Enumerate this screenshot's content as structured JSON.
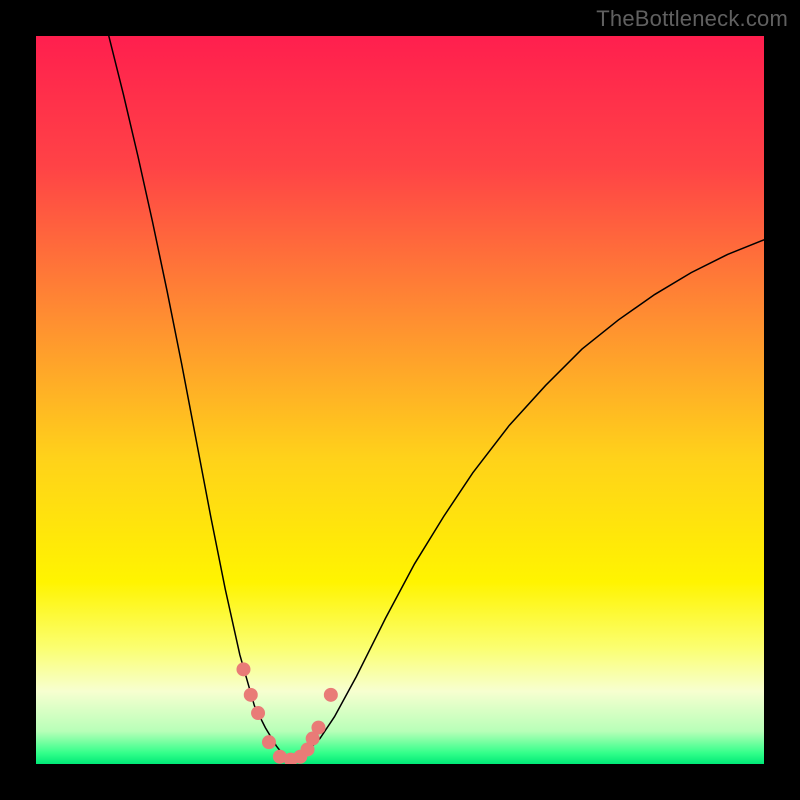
{
  "watermark": "TheBottleneck.com",
  "chart_data": {
    "type": "line",
    "title": "",
    "xlabel": "",
    "ylabel": "",
    "xlim": [
      0,
      100
    ],
    "ylim": [
      0,
      100
    ],
    "grid": false,
    "background_gradient": {
      "direction": "vertical",
      "stops": [
        {
          "offset": 0.0,
          "color": "#ff1f4e"
        },
        {
          "offset": 0.18,
          "color": "#ff4346"
        },
        {
          "offset": 0.38,
          "color": "#ff8b32"
        },
        {
          "offset": 0.58,
          "color": "#ffd21a"
        },
        {
          "offset": 0.75,
          "color": "#fff400"
        },
        {
          "offset": 0.84,
          "color": "#fbff70"
        },
        {
          "offset": 0.9,
          "color": "#f7ffd0"
        },
        {
          "offset": 0.955,
          "color": "#b8ffb8"
        },
        {
          "offset": 0.985,
          "color": "#33ff8a"
        },
        {
          "offset": 1.0,
          "color": "#00e877"
        }
      ]
    },
    "series": [
      {
        "name": "curve-left",
        "color": "#000000",
        "stroke_width_px": 1.5,
        "x": [
          10.0,
          12.0,
          14.0,
          16.0,
          18.0,
          20.0,
          22.0,
          24.0,
          26.0,
          28.0,
          30.0,
          31.5,
          33.0,
          34.0,
          35.0
        ],
        "y": [
          100.0,
          92.0,
          83.5,
          74.5,
          65.0,
          55.0,
          44.5,
          34.0,
          24.0,
          15.0,
          8.0,
          5.0,
          2.5,
          1.2,
          0.5
        ]
      },
      {
        "name": "curve-right",
        "color": "#000000",
        "stroke_width_px": 1.5,
        "x": [
          35.0,
          37.0,
          39.0,
          41.0,
          44.0,
          48.0,
          52.0,
          56.0,
          60.0,
          65.0,
          70.0,
          75.0,
          80.0,
          85.0,
          90.0,
          95.0,
          100.0
        ],
        "y": [
          0.5,
          1.5,
          3.5,
          6.5,
          12.0,
          20.0,
          27.5,
          34.0,
          40.0,
          46.5,
          52.0,
          57.0,
          61.0,
          64.5,
          67.5,
          70.0,
          72.0
        ]
      },
      {
        "name": "markers",
        "color": "#e97b77",
        "type": "scatter",
        "marker_radius_px": 7,
        "x": [
          28.5,
          29.5,
          30.5,
          32.0,
          33.5,
          35.0,
          36.3,
          37.3,
          38.0,
          38.8,
          40.5
        ],
        "y": [
          13.0,
          9.5,
          7.0,
          3.0,
          1.0,
          0.6,
          1.0,
          2.0,
          3.5,
          5.0,
          9.5
        ]
      }
    ]
  }
}
